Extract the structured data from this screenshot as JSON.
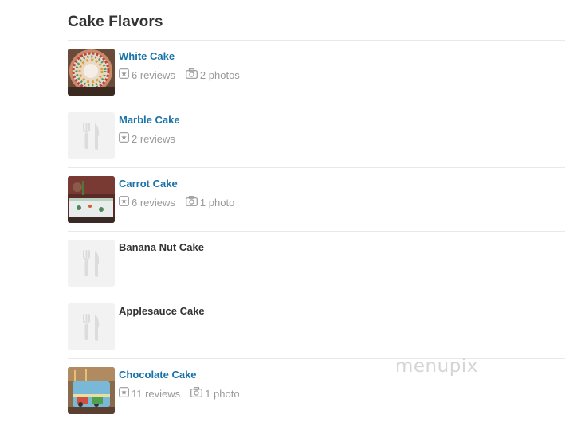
{
  "section": {
    "title": "Cake Flavors"
  },
  "items": [
    {
      "name": "White Cake",
      "has_photo": true,
      "reviews_label": "6 reviews",
      "photos_label": "2 photos"
    },
    {
      "name": "Marble Cake",
      "has_photo": false,
      "reviews_label": "2 reviews",
      "photos_label": null
    },
    {
      "name": "Carrot Cake",
      "has_photo": true,
      "reviews_label": "6 reviews",
      "photos_label": "1 photo"
    },
    {
      "name": "Banana Nut Cake",
      "has_photo": false,
      "reviews_label": null,
      "photos_label": null
    },
    {
      "name": "Applesauce Cake",
      "has_photo": false,
      "reviews_label": null,
      "photos_label": null
    },
    {
      "name": "Chocolate Cake",
      "has_photo": true,
      "reviews_label": "11 reviews",
      "photos_label": "1 photo"
    }
  ],
  "watermark": {
    "text": "menupix"
  },
  "colors": {
    "link": "#1a73a8",
    "heading": "#333333",
    "meta": "#999999",
    "divider": "#e8e8e8",
    "placeholder_bg": "#f2f2f2"
  },
  "icons": {
    "review": "star-in-box-icon",
    "photo": "camera-icon",
    "placeholder": "fork-knife-icon"
  }
}
